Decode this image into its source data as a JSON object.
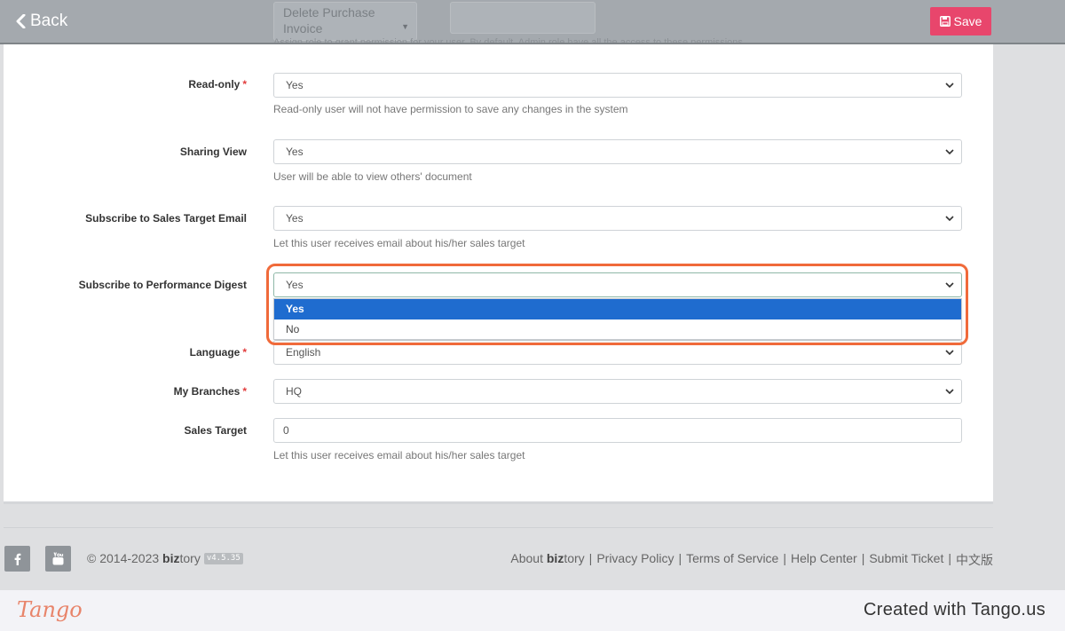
{
  "header": {
    "back_label": "Back",
    "save_label": "Save",
    "ghost_select_value": "Delete Purchase Invoice",
    "ghost_help_text": "Assign role to grant permission for your user. By default, Admin role have all the access to these permissions."
  },
  "form": {
    "readonly": {
      "label": "Read-only",
      "required": "*",
      "value": "Yes",
      "help": "Read-only user will not have permission to save any changes in the system"
    },
    "sharing": {
      "label": "Sharing View",
      "value": "Yes",
      "help": "User will be able to view others' document"
    },
    "sales_email": {
      "label": "Subscribe to Sales Target Email",
      "value": "Yes",
      "help": "Let this user receives email about his/her sales target"
    },
    "perf_digest": {
      "label": "Subscribe to Performance Digest",
      "value": "Yes",
      "options": [
        "Yes",
        "No"
      ]
    },
    "language": {
      "label": "Language",
      "required": "*",
      "value": "English"
    },
    "branches": {
      "label": "My Branches",
      "required": "*",
      "value": "HQ"
    },
    "sales_target": {
      "label": "Sales Target",
      "value": "0",
      "help": "Let this user receives email about his/her sales target"
    }
  },
  "footer": {
    "copyright_prefix": "© 2014-2023",
    "brand_bold": "biz",
    "brand_rest": "tory",
    "version": "v4.5.35",
    "about_prefix": "About",
    "links": [
      "Privacy Policy",
      "Terms of Service",
      "Help Center",
      "Submit Ticket",
      "中文版"
    ],
    "separator": "|"
  },
  "tango": {
    "logo": "Tango",
    "credit": "Created with Tango.us"
  },
  "colors": {
    "save": "#e8466c",
    "selected_option": "#1f6ccf",
    "highlight": "#f06a3a",
    "required": "#e23d3d"
  }
}
